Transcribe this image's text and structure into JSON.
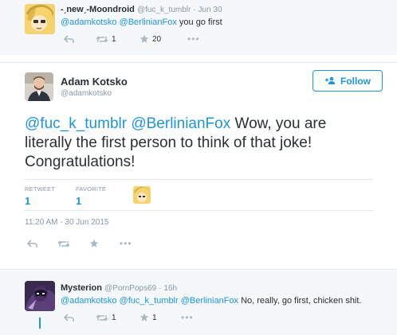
{
  "parent_tweet": {
    "display_name": "-ˏnewˏ-Moondroid",
    "handle": "@fuc_k_tumblr",
    "time": "· Jun 30",
    "mentions": "@adamkotsko @BerlinianFox",
    "text_rest": " you go first",
    "retweets": "1",
    "favorites": "20"
  },
  "main_tweet": {
    "display_name": "Adam Kotsko",
    "handle": "@adamkotsko",
    "follow_label": "Follow",
    "mentions": "@fuc_k_tumblr @BerlinianFox",
    "text_rest": " Wow, you are literally the first person to think of that joke! Congratulations!",
    "retweet_label": "RETWEET",
    "retweet_count": "1",
    "favorite_label": "FAVORITE",
    "favorite_count": "1",
    "timestamp": "11:20 AM - 30 Jun 2015"
  },
  "reply_tweet": {
    "display_name": "Mysterion",
    "handle": "@PornPops69",
    "time": "· 16h",
    "mentions": "@adamkotsko @fuc_k_tumblr @BerlinianFox",
    "text_rest": " No, really, go first, chicken shit.",
    "retweets": "1",
    "favorites": "1"
  },
  "icons": {
    "reply": "reply-icon",
    "retweet": "retweet-icon",
    "favorite": "star-icon",
    "more": "more-icon",
    "follow": "add-user-icon"
  },
  "colors": {
    "accent": "#1b95e0",
    "muted": "#8899a6",
    "icon": "#aab8c2",
    "text": "#292f33"
  }
}
